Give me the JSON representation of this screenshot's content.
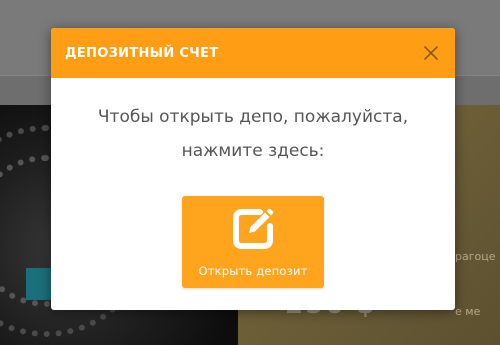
{
  "modal": {
    "title": "ДЕПОЗИТНЫЙ СЧЕТ",
    "message_line1": "Чтобы открыть депо, пожалуйста,",
    "message_line2": "нажмите здесь:",
    "button_label": "Открыть депозит",
    "close_icon": "close-icon",
    "button_icon": "edit-icon"
  },
  "background": {
    "text1": "рагоце",
    "text2": "е ме",
    "big_text": "256 $"
  },
  "colors": {
    "header": "#ff9e15",
    "button": "#ffa41c",
    "text": "#555555"
  }
}
